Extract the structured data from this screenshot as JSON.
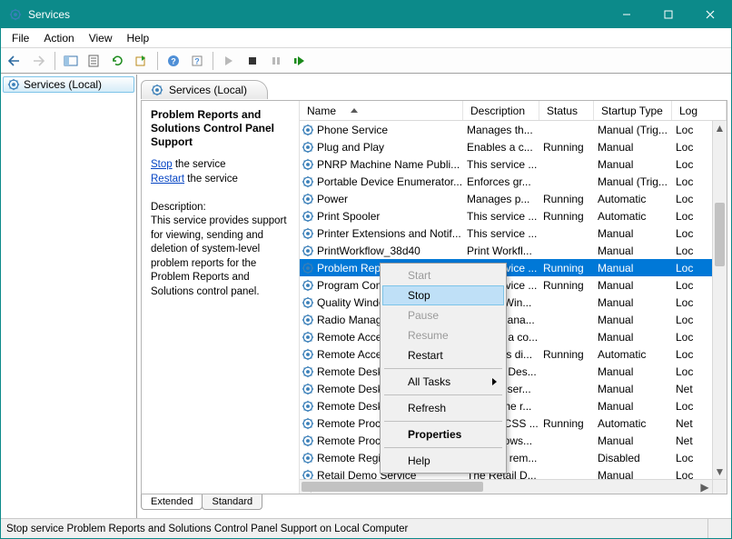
{
  "window": {
    "title": "Services"
  },
  "menu": {
    "file": "File",
    "action": "Action",
    "view": "View",
    "help": "Help"
  },
  "tree": {
    "root": "Services (Local)"
  },
  "header_tab": "Services (Local)",
  "detail": {
    "title": "Problem Reports and Solutions Control Panel Support",
    "stop_link": "Stop",
    "stop_suffix": " the service",
    "restart_link": "Restart",
    "restart_suffix": " the service",
    "desc_label": "Description:",
    "desc_text": "This service provides support for viewing, sending and deletion of system-level problem reports for the Problem Reports and Solutions control panel."
  },
  "columns": {
    "name": "Name",
    "desc": "Description",
    "status": "Status",
    "startup": "Startup Type",
    "logon": "Log"
  },
  "services": [
    {
      "name": "Phone Service",
      "desc": "Manages th...",
      "status": "",
      "startup": "Manual (Trig...",
      "logon": "Loc"
    },
    {
      "name": "Plug and Play",
      "desc": "Enables a c...",
      "status": "Running",
      "startup": "Manual",
      "logon": "Loc"
    },
    {
      "name": "PNRP Machine Name Publi...",
      "desc": "This service ...",
      "status": "",
      "startup": "Manual",
      "logon": "Loc"
    },
    {
      "name": "Portable Device Enumerator...",
      "desc": "Enforces gr...",
      "status": "",
      "startup": "Manual (Trig...",
      "logon": "Loc"
    },
    {
      "name": "Power",
      "desc": "Manages p...",
      "status": "Running",
      "startup": "Automatic",
      "logon": "Loc"
    },
    {
      "name": "Print Spooler",
      "desc": "This service ...",
      "status": "Running",
      "startup": "Automatic",
      "logon": "Loc"
    },
    {
      "name": "Printer Extensions and Notif...",
      "desc": "This service ...",
      "status": "",
      "startup": "Manual",
      "logon": "Loc"
    },
    {
      "name": "PrintWorkflow_38d40",
      "desc": "Print Workfl...",
      "status": "",
      "startup": "Manual",
      "logon": "Loc"
    },
    {
      "name": "Problem Reports and Soluti...",
      "desc": "This service ...",
      "status": "Running",
      "startup": "Manual",
      "logon": "Loc",
      "selected": true
    },
    {
      "name": "Program Compatibility Assi...",
      "desc": "This service ...",
      "status": "Running",
      "startup": "Manual",
      "logon": "Loc"
    },
    {
      "name": "Quality Windows Audio Vid...",
      "desc": "Quality Win...",
      "status": "",
      "startup": "Manual",
      "logon": "Loc"
    },
    {
      "name": "Radio Management Service",
      "desc": "Radio Mana...",
      "status": "",
      "startup": "Manual",
      "logon": "Loc"
    },
    {
      "name": "Remote Access Auto Conne...",
      "desc": "Creates a co...",
      "status": "",
      "startup": "Manual",
      "logon": "Loc"
    },
    {
      "name": "Remote Access Connection...",
      "desc": "Manages di...",
      "status": "Running",
      "startup": "Automatic",
      "logon": "Loc"
    },
    {
      "name": "Remote Desktop Configurat...",
      "desc": "Remote Des...",
      "status": "",
      "startup": "Manual",
      "logon": "Loc"
    },
    {
      "name": "Remote Desktop Services",
      "desc": "Allows user...",
      "status": "",
      "startup": "Manual",
      "logon": "Net"
    },
    {
      "name": "Remote Desktop Services U...",
      "desc": "Allows the r...",
      "status": "",
      "startup": "Manual",
      "logon": "Loc"
    },
    {
      "name": "Remote Procedure Call (RPC)",
      "desc": "The RPCSS ...",
      "status": "Running",
      "startup": "Automatic",
      "logon": "Net"
    },
    {
      "name": "Remote Procedure Call (RP...",
      "desc": "In Windows...",
      "status": "",
      "startup": "Manual",
      "logon": "Net"
    },
    {
      "name": "Remote Registry",
      "desc": "Enables rem...",
      "status": "",
      "startup": "Disabled",
      "logon": "Loc"
    },
    {
      "name": "Retail Demo Service",
      "desc": "The Retail D...",
      "status": "",
      "startup": "Manual",
      "logon": "Loc"
    }
  ],
  "context_menu": {
    "start": "Start",
    "stop": "Stop",
    "pause": "Pause",
    "resume": "Resume",
    "restart": "Restart",
    "alltasks": "All Tasks",
    "refresh": "Refresh",
    "properties": "Properties",
    "help": "Help"
  },
  "tabs": {
    "extended": "Extended",
    "standard": "Standard"
  },
  "statusbar": "Stop service Problem Reports and Solutions Control Panel Support on Local Computer"
}
